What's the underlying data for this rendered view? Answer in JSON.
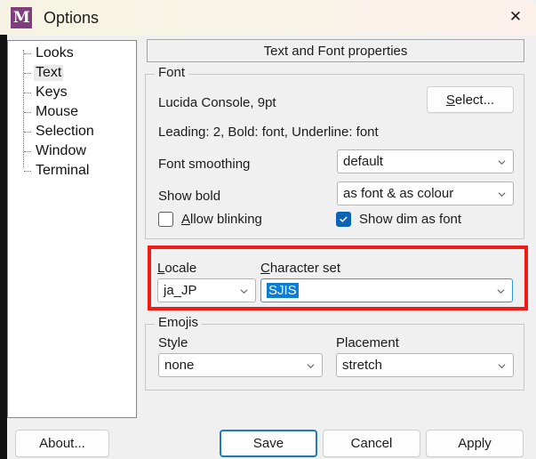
{
  "window": {
    "title": "Options",
    "app_icon": "app-icon-m",
    "icon_letter": "M",
    "close_icon": "close-icon",
    "close_glyph": "✕",
    "accent_blue": "#0c7cd5",
    "highlight_red": "#ee1b17",
    "icon_purple": "#7f3f7f"
  },
  "sidebar": {
    "items": [
      {
        "label": "Looks",
        "selected": false
      },
      {
        "label": "Text",
        "selected": true
      },
      {
        "label": "Keys",
        "selected": false
      },
      {
        "label": "Mouse",
        "selected": false
      },
      {
        "label": "Selection",
        "selected": false
      },
      {
        "label": "Window",
        "selected": false
      },
      {
        "label": "Terminal",
        "selected": false
      }
    ]
  },
  "page_header": "Text and Font properties",
  "font_group": {
    "title": "Font",
    "current_font": "Lucida Console, 9pt",
    "font_details": "Leading: 2, Bold: font, Underline: font",
    "select_button": {
      "accel": "S",
      "rest": "elect..."
    },
    "smoothing": {
      "label": "Font smoothing",
      "value": "default"
    },
    "show_bold": {
      "label": "Show bold",
      "value": "as font & as colour"
    },
    "allow_blinking": {
      "accel": "A",
      "rest": "llow blinking",
      "checked": false
    },
    "show_dim_as_font": {
      "label": "Show dim as font",
      "checked": true
    }
  },
  "locale_group": {
    "locale": {
      "accel": "L",
      "rest": "ocale",
      "value": "ja_JP"
    },
    "charset": {
      "accel": "C",
      "rest": "haracter set",
      "value": "SJIS",
      "focused": true,
      "selected": true
    }
  },
  "emojis_group": {
    "title": "Emojis",
    "style": {
      "label": "Style",
      "value": "none"
    },
    "placement": {
      "label": "Placement",
      "value": "stretch"
    }
  },
  "buttons": {
    "about": "About...",
    "save": "Save",
    "cancel": "Cancel",
    "apply": "Apply"
  }
}
